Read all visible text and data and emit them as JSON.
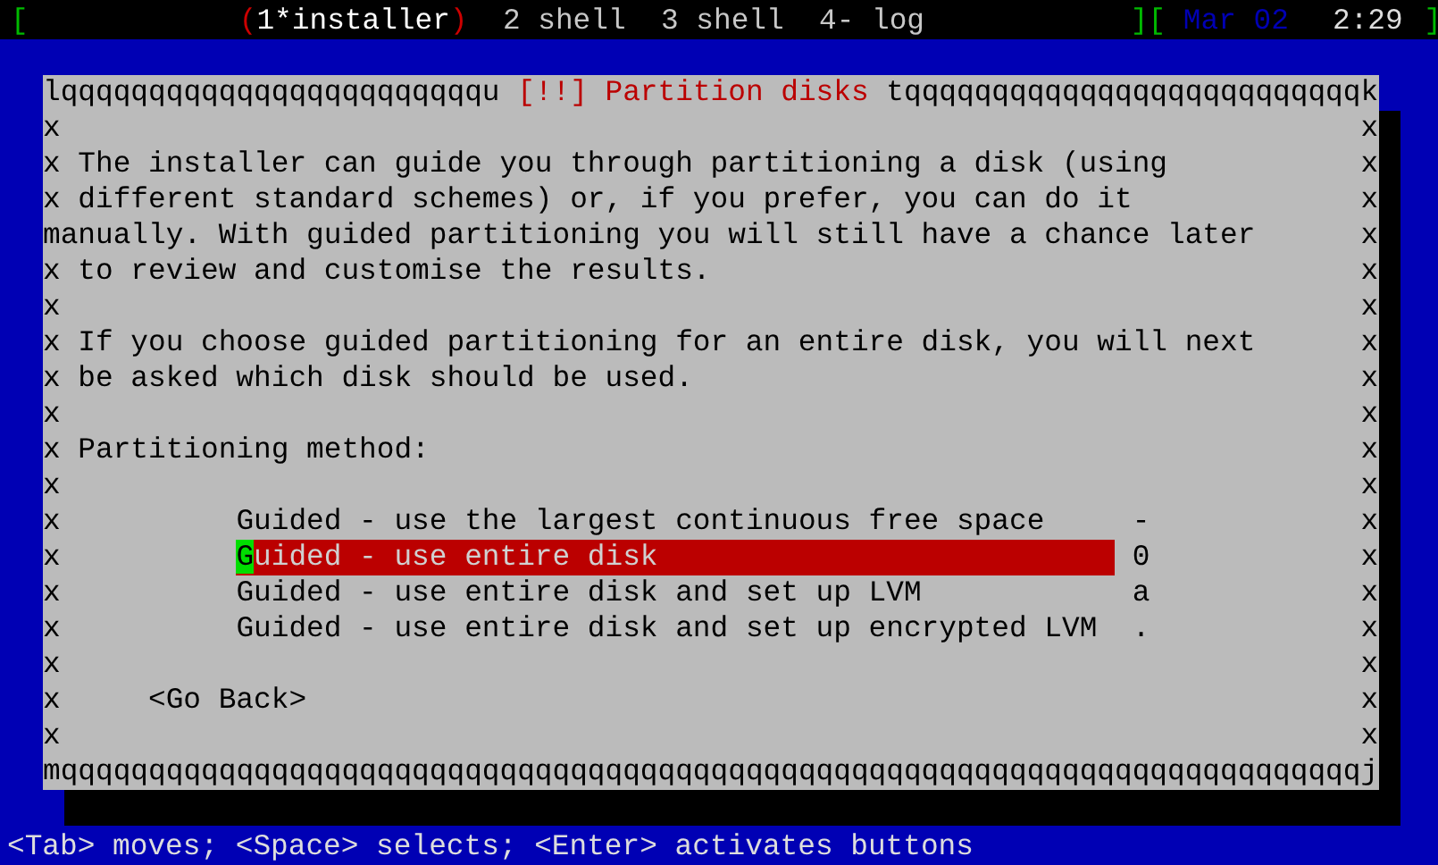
{
  "top_bar": {
    "left_bracket": "[",
    "windows": [
      {
        "before": "(",
        "label": "1*installer",
        "after": ")",
        "selected": true
      },
      {
        "label": "2 shell",
        "selected": false
      },
      {
        "label": "3 shell",
        "selected": false
      },
      {
        "label": "4- log",
        "selected": false
      }
    ],
    "separator": "][",
    "date": "Mar 02",
    "time": "2:29",
    "right_bracket": "]"
  },
  "dialog": {
    "border_top_left": "lqqqqqqqqqqqqqqqqqqqqqqqqu",
    "title": "[!!] Partition disks",
    "border_top_right": "tqqqqqqqqqqqqqqqqqqqqqqqqqqk",
    "rows": [
      {
        "kind": "blank",
        "left": "x",
        "right": "x"
      },
      {
        "kind": "text",
        "left": "x",
        "text": "The installer can guide you through partitioning a disk (using",
        "right": "x"
      },
      {
        "kind": "text",
        "left": "x",
        "text": "different standard schemes) or, if you prefer, you can do it",
        "right": "x"
      },
      {
        "kind": "text",
        "text": "manually. With guided partitioning you will still have a chance later",
        "right": "x"
      },
      {
        "kind": "text",
        "left": "x",
        "text": "to review and customise the results.",
        "right": "x"
      },
      {
        "kind": "blank",
        "left": "x",
        "right": "x"
      },
      {
        "kind": "text",
        "left": "x",
        "text": "If you choose guided partitioning for an entire disk, you will next",
        "right": "x"
      },
      {
        "kind": "text",
        "left": "x",
        "text": "be asked which disk should be used.",
        "right": "x"
      },
      {
        "kind": "blank",
        "left": "x",
        "right": "x"
      },
      {
        "kind": "text",
        "left": "x",
        "text": "Partitioning method:",
        "right": "x"
      },
      {
        "kind": "blank",
        "left": "x",
        "right": "x"
      },
      {
        "kind": "option",
        "left": "x",
        "text": "Guided - use the largest continuous free space",
        "marker": "-",
        "selected": false,
        "right": "x"
      },
      {
        "kind": "option",
        "left": "x",
        "text": "Guided - use entire disk",
        "marker": "0",
        "selected": true,
        "right": "x"
      },
      {
        "kind": "option",
        "left": "x",
        "text": "Guided - use entire disk and set up LVM",
        "marker": "a",
        "selected": false,
        "right": "x"
      },
      {
        "kind": "option",
        "left": "x",
        "text": "Guided - use entire disk and set up encrypted LVM",
        "marker": ".",
        "selected": false,
        "right": "x"
      },
      {
        "kind": "blank",
        "left": "x",
        "right": "x"
      },
      {
        "kind": "button",
        "left": "x",
        "text": "<Go Back>",
        "right": "x"
      },
      {
        "kind": "blank",
        "left": "x",
        "right": "x"
      }
    ],
    "border_bottom": "mqqqqqqqqqqqqqqqqqqqqqqqqqqqqqqqqqqqqqqqqqqqqqqqqqqqqqqqqqqqqqqqqqqqqqqqqqqj"
  },
  "help_line": "<Tab> moves; <Space> selects; <Enter> activates buttons"
}
